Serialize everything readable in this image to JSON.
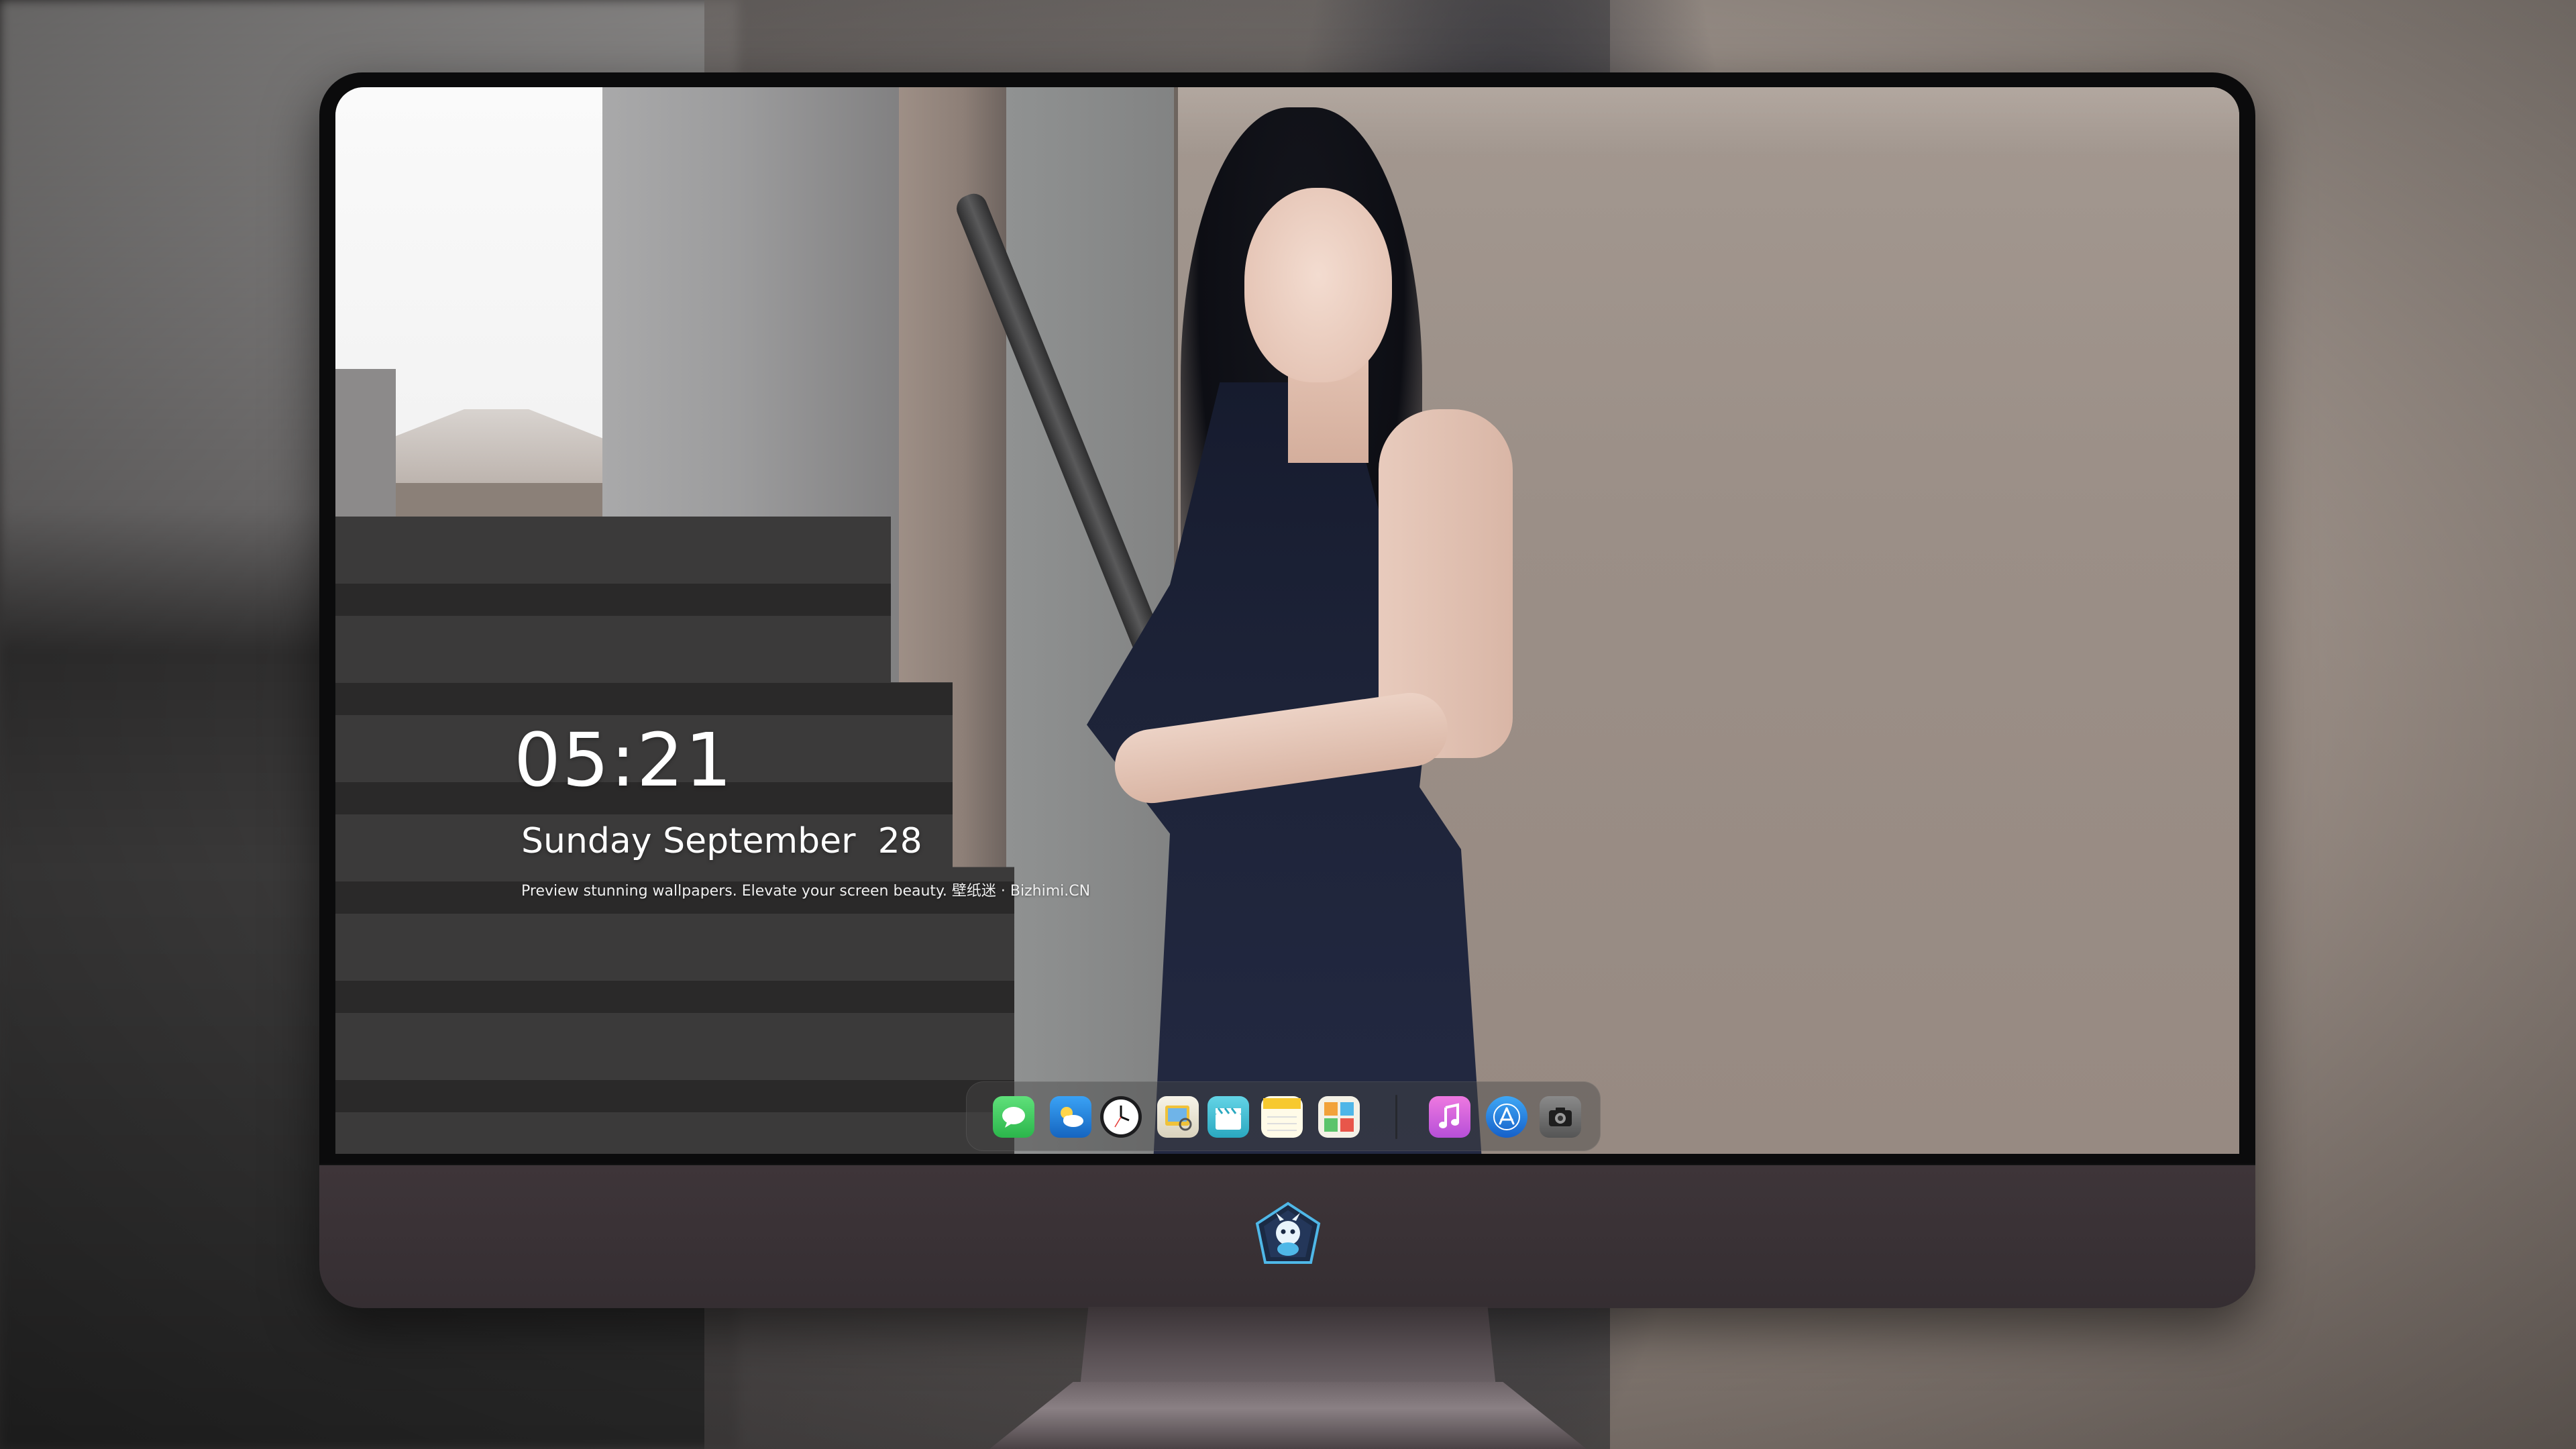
{
  "lock_screen": {
    "time": "05:21",
    "date": "Sunday September  28",
    "tagline": "Preview stunning wallpapers. Elevate your screen beauty. 壁纸迷 · Bizhimi.CN"
  },
  "dock": {
    "apps": [
      {
        "name": "Messages",
        "icon": "messages-icon",
        "color": "#34c759"
      },
      {
        "name": "Weather",
        "icon": "weather-icon",
        "color": "#1e88e5"
      },
      {
        "name": "Clock",
        "icon": "clock-icon",
        "color": "#1c1c1e"
      },
      {
        "name": "Preview",
        "icon": "preview-icon",
        "color": "#f0c23a"
      },
      {
        "name": "Clips",
        "icon": "clips-icon",
        "color": "#46c3d6"
      },
      {
        "name": "Notes",
        "icon": "notes-icon",
        "color": "#f7d34a"
      },
      {
        "name": "Photo Booth",
        "icon": "photo-booth-icon",
        "color": "#f2a23a"
      },
      {
        "name": "iTunes",
        "icon": "music-icon",
        "color": "#d85ad6"
      },
      {
        "name": "App Store",
        "icon": "app-store-icon",
        "color": "#1e88e5"
      },
      {
        "name": "Camera",
        "icon": "camera-icon",
        "color": "#6b6b6b"
      }
    ]
  },
  "monitor": {
    "logo": "dragon-logo-icon"
  },
  "colors": {
    "chin": "#3e3539",
    "bezel": "#0b0b0c",
    "stand": "#6e6468"
  }
}
